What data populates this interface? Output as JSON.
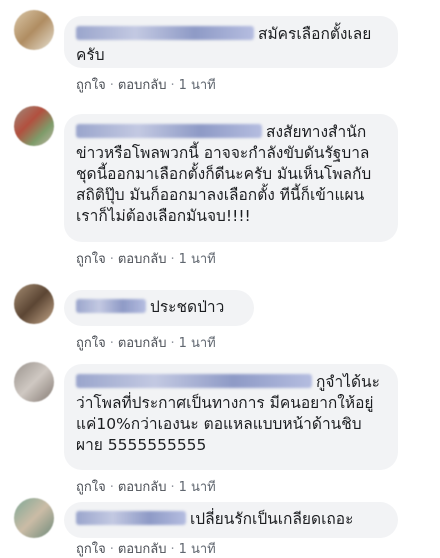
{
  "comments": [
    {
      "text": "สมัครเลือกตั้งเลยครับ",
      "like_label": "ถูกใจ",
      "reply_label": "ตอบกลับ",
      "time": "1 นาที"
    },
    {
      "text": "สงสัยทางสำนักข่าวหรือโพลพวกนี้ อาจจะกำลังขับดันรัฐบาลชุดนี้ออกมาเลือกตั้งก็ดีนะครับ มันเห็นโพลกับสถิติปุ๊บ มันก็ออกมาลงเลือกตั้ง ทีนี้ก็เข้าแผน เราก็ไม่ต้องเลือกมันจบ!!!!",
      "like_label": "ถูกใจ",
      "reply_label": "ตอบกลับ",
      "time": "1 นาที"
    },
    {
      "text": "ประชดป่าว",
      "like_label": "ถูกใจ",
      "reply_label": "ตอบกลับ",
      "time": "1 นาที"
    },
    {
      "text": "กูจำได้นะว่าโพลที่ประกาศเป็นทางการ มีคนอยากให้อยู่แค่10%กว่าเองนะ ตอแหลแบบหน้าด้านชิบผาย 5555555555",
      "like_label": "ถูกใจ",
      "reply_label": "ตอบกลับ",
      "time": "1 นาที"
    },
    {
      "text": "เปลี่ยนรักเป็นเกลียดเถอะ",
      "like_label": "ถูกใจ",
      "reply_label": "ตอบกลับ",
      "time": "1 นาที"
    }
  ]
}
